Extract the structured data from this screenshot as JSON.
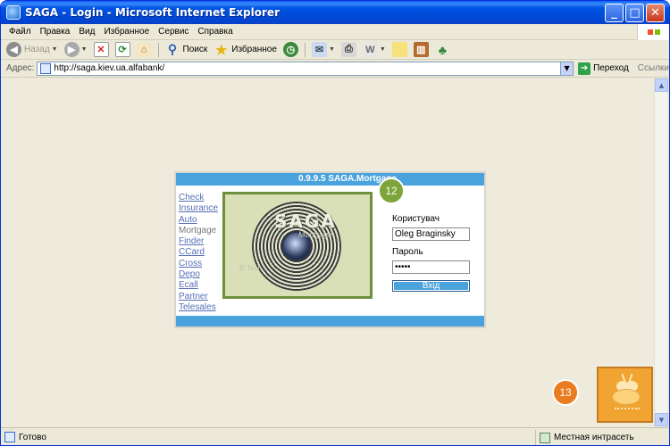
{
  "window": {
    "title": "SAGA - Login - Microsoft Internet Explorer",
    "minimize_glyph": "_",
    "maximize_glyph": "□",
    "close_glyph": "✕"
  },
  "menu": [
    "Файл",
    "Правка",
    "Вид",
    "Избранное",
    "Сервис",
    "Справка"
  ],
  "toolbar": {
    "back": "Назад",
    "search": "Поиск",
    "favorites": "Избранное"
  },
  "address": {
    "label": "Адрес:",
    "url": "http://saga.kiev.ua.alfabank/",
    "go": "Переход",
    "links": "Ссылки"
  },
  "status": {
    "text": "Готово",
    "zone": "Местная интрасеть"
  },
  "login": {
    "header": "0.9.9.5  SAGA.Mortgage",
    "nav": [
      "Check",
      "Insurance",
      "Auto",
      "Mortgage",
      "Finder",
      "CCard",
      "Cross",
      "Depo",
      "Ecall",
      "Partner",
      "Telesales"
    ],
    "current_nav": "Mortgage",
    "logo_text": "SAGA",
    "logo_sub": "Mortgage",
    "logo_corner": "B-Tech",
    "user_label": "Користувач",
    "user_value": "Oleg Braginsky",
    "password_label": "Пароль",
    "password_value": "•••••",
    "submit": "Вхід"
  },
  "callouts": {
    "a": "12",
    "b": "13"
  },
  "colors": {
    "title_bar": "#0055e5",
    "panel_header": "#4aa3dc",
    "logo_frame": "#6e8f3c",
    "callout_green": "#7ea53a",
    "callout_orange": "#e97c1f"
  }
}
